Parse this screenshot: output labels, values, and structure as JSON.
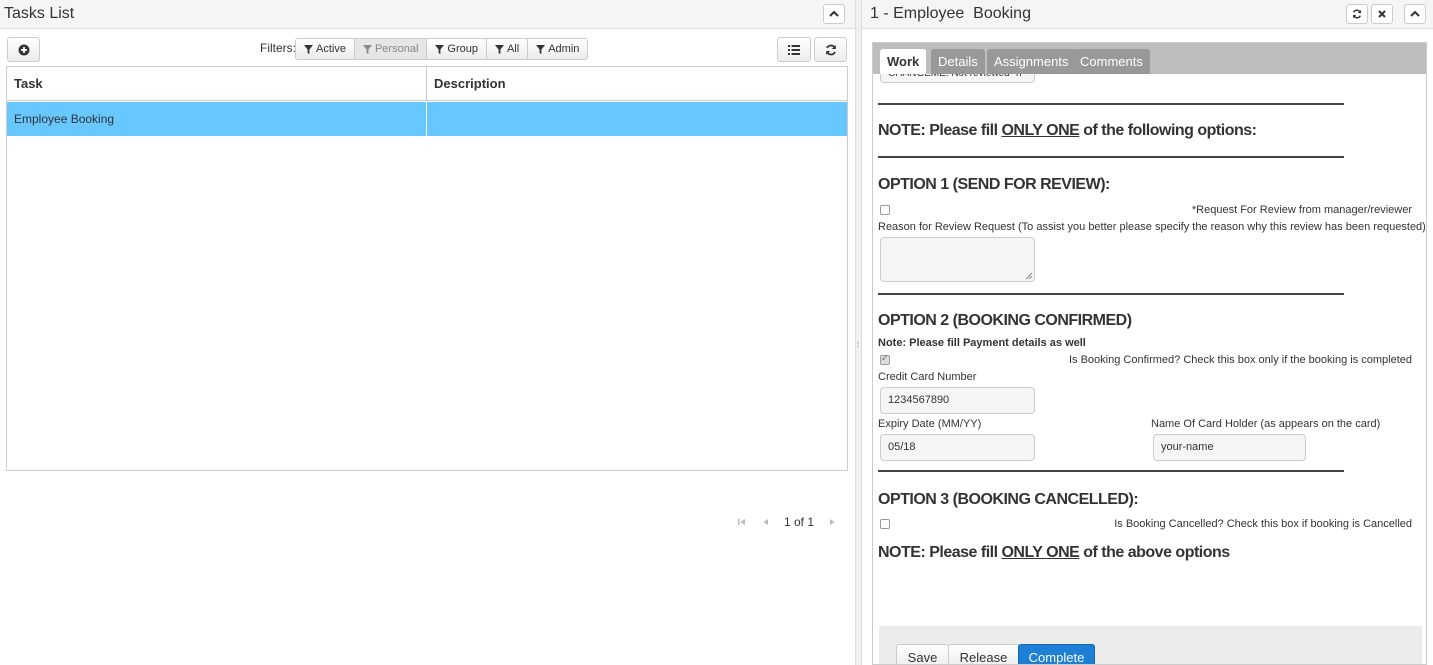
{
  "left_panel": {
    "title": "Tasks List",
    "filters_label": "Filters:",
    "filters": [
      {
        "label": "Active",
        "active": true
      },
      {
        "label": "Personal",
        "active": false
      },
      {
        "label": "Group",
        "active": true
      },
      {
        "label": "All",
        "active": true
      },
      {
        "label": "Admin",
        "active": true
      }
    ],
    "table": {
      "columns": [
        "Task",
        "Description"
      ],
      "rows": [
        {
          "task": "Employee Booking",
          "description": "",
          "selected": true
        }
      ]
    },
    "pager": {
      "text": "1 of 1"
    }
  },
  "right_panel": {
    "title": "1 - Employee  Booking",
    "tabs": [
      {
        "label": "Work",
        "active": true
      },
      {
        "label": "Details",
        "active": false
      },
      {
        "label": "Assignments",
        "active": false
      },
      {
        "label": "Comments",
        "active": false
      }
    ],
    "form": {
      "top_field_value": "CHANGEME: Not reviewed \"n",
      "note1_pre": "NOTE: Please fill ",
      "note1_u": "ONLY ONE",
      "note1_post": " of the following options:",
      "option1_heading": "OPTION 1 (SEND FOR REVIEW):",
      "option1_checkbox_label": "*Request For Review from manager/reviewer",
      "option1_checked": false,
      "option1_reason_label": "Reason for Review Request (To assist you better please specify the reason why this review has been requested)",
      "option2_heading": "OPTION 2 (BOOKING CONFIRMED)",
      "option2_note": "Note: Please fill Payment details as well",
      "option2_checkbox_label": "Is Booking Confirmed? Check this box only if the booking is completed",
      "option2_checked": true,
      "credit_card_label": "Credit Card Number",
      "credit_card_value": "1234567890",
      "expiry_label": "Expiry Date (MM/YY)",
      "expiry_value": "05/18",
      "card_holder_label": "Name Of Card Holder (as appears on the card)",
      "card_holder_value": "your-name",
      "option3_heading": "OPTION 3 (BOOKING CANCELLED):",
      "option3_checkbox_label": "Is Booking Cancelled? Check this box if booking is Cancelled",
      "option3_checked": false,
      "note2_pre": "NOTE: Please fill ",
      "note2_u": "ONLY ONE",
      "note2_post": " of the above options"
    },
    "buttons": {
      "save": "Save",
      "release": "Release",
      "complete": "Complete"
    }
  },
  "icons": {
    "add": "plus-circle-icon",
    "list": "list-icon",
    "refresh": "refresh-icon",
    "collapse": "chevron-up-icon",
    "close": "close-icon",
    "filter": "filter-icon",
    "first": "first-page-icon",
    "prev": "prev-page-icon",
    "next": "next-page-icon"
  },
  "colors": {
    "selected_row": "#66c8ff",
    "primary_button": "#1e7fd6"
  }
}
